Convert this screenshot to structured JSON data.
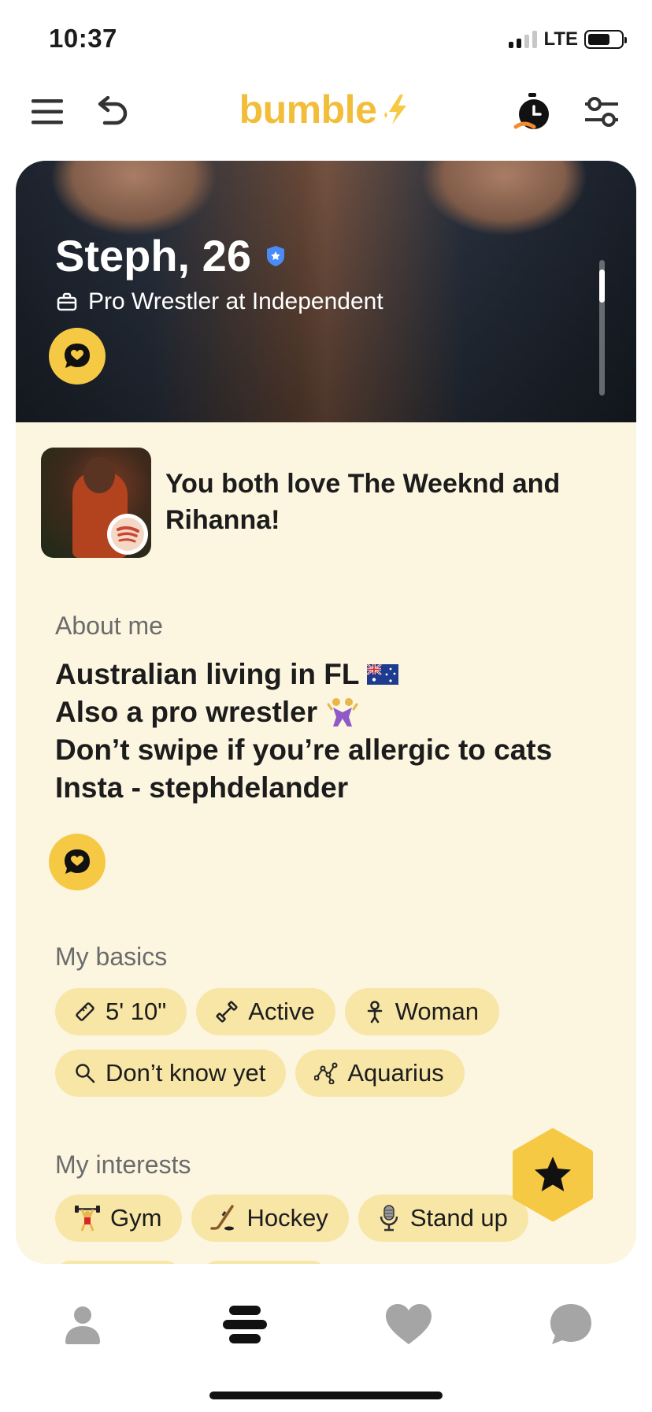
{
  "status_bar": {
    "time": "10:37",
    "network": "LTE",
    "signal_bars": 2,
    "battery_level": 0.7
  },
  "header": {
    "brand": "bumble",
    "brand_color": "#f2be3a",
    "left_icons": [
      "menu-icon",
      "undo-icon"
    ],
    "right_icons": [
      "timer-icon",
      "filter-icon"
    ]
  },
  "profile": {
    "name_age": "Steph, 26",
    "verified": true,
    "job": "Pro Wrestler at Independent",
    "spotify_match": "You both love The Weeknd and Rihanna!",
    "about": {
      "title": "About me",
      "lines": [
        "Australian living in FL",
        "Also a pro wrestler",
        "Don’t swipe if you’re allergic to cats",
        "Insta - stephdelander"
      ]
    },
    "basics": {
      "title": "My basics",
      "items": [
        "5' 10\"",
        "Active",
        "Woman",
        "Don’t know yet",
        "Aquarius"
      ]
    },
    "interests": {
      "title": "My interests",
      "items": [
        "Gym",
        "Hockey",
        "Stand up"
      ]
    }
  },
  "tabs": [
    "profile-tab",
    "people-tab",
    "liked-you-tab",
    "chats-tab"
  ],
  "colors": {
    "accent": "#f6c945",
    "card_bg": "#fcf5e0",
    "chip_bg": "#f8e6a7",
    "verified_blue": "#4a8cf7"
  }
}
